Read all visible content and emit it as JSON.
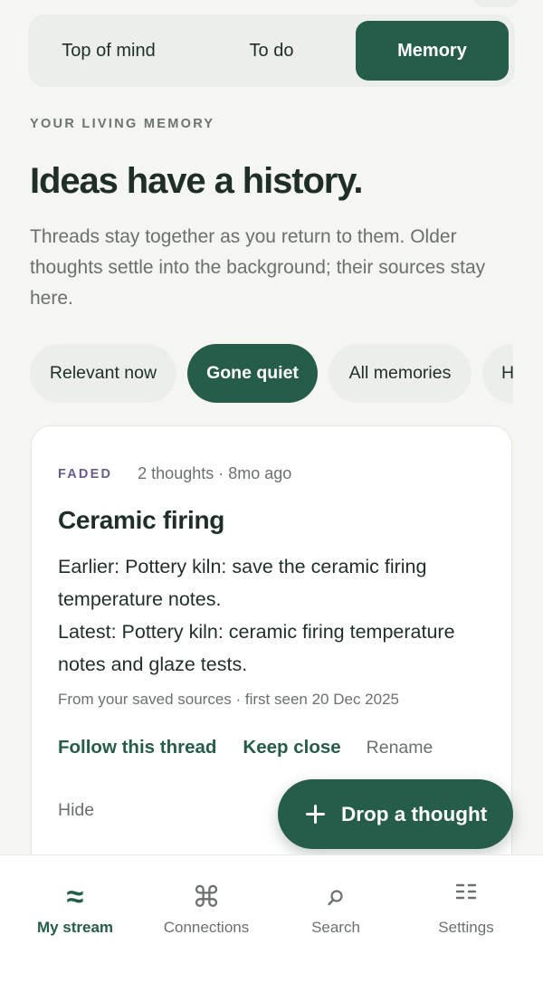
{
  "tabs": [
    {
      "label": "Top of mind",
      "active": false
    },
    {
      "label": "To do",
      "active": false
    },
    {
      "label": "Memory",
      "active": true
    }
  ],
  "section": {
    "kicker": "YOUR LIVING MEMORY",
    "title": "Ideas have a history.",
    "description": "Threads stay together as you return to them. Older thoughts settle into the background; their sources stay here."
  },
  "filters": [
    {
      "label": "Relevant now",
      "active": false
    },
    {
      "label": "Gone quiet",
      "active": true
    },
    {
      "label": "All memories",
      "active": false
    },
    {
      "label": "H",
      "active": false
    }
  ],
  "card": {
    "badge": "FADED",
    "meta": "2 thoughts · 8mo ago",
    "title": "Ceramic firing",
    "earlier": "Earlier: Pottery kiln: save the ceramic firing temperature notes.",
    "latest": "Latest: Pottery kiln: ceramic firing temperature notes and glaze tests.",
    "source": "From your saved sources · first seen 20 Dec 2025",
    "actions": {
      "follow": "Follow this thread",
      "keep": "Keep close",
      "rename": "Rename",
      "hide": "Hide"
    }
  },
  "fab": {
    "label": "Drop a thought",
    "icon": "plus-icon"
  },
  "nav": [
    {
      "label": "My stream",
      "icon": "waves-icon",
      "glyph": "≈",
      "active": true
    },
    {
      "label": "Connections",
      "icon": "command-icon",
      "glyph": "⌘",
      "active": false
    },
    {
      "label": "Search",
      "icon": "search-icon",
      "active": false
    },
    {
      "label": "Settings",
      "icon": "settings-list-icon",
      "active": false
    }
  ],
  "colors": {
    "accent": "#265c4a",
    "background": "#f5f5f2",
    "chip": "#ecefe9",
    "muted_text": "#6a716d",
    "badge": "#6b5b8c"
  }
}
